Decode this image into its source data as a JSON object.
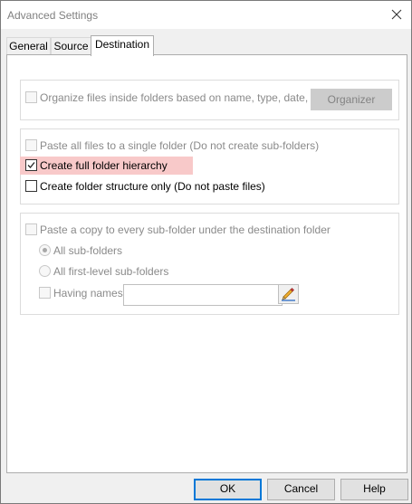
{
  "window": {
    "title": "Advanced Settings"
  },
  "tabs": [
    {
      "label": "General"
    },
    {
      "label": "Source"
    },
    {
      "label": "Destination",
      "active": true
    }
  ],
  "organize": {
    "checkbox_label": "Organize files inside folders based on name, type, date, etc",
    "checked": false,
    "enabled": false,
    "organizer_button": "Organizer"
  },
  "structure": {
    "paste_single_label": "Paste all files to a single folder (Do not create sub-folders)",
    "paste_single_checked": false,
    "full_hierarchy_label": "Create full folder hierarchy",
    "full_hierarchy_checked": true,
    "structure_only_label": "Create folder structure only (Do not paste files)",
    "structure_only_checked": false
  },
  "subfolder": {
    "paste_copy_label": "Paste a copy to every sub-folder under the destination folder",
    "paste_copy_checked": false,
    "all_subfolders_label": "All sub-folders",
    "all_subfolders_selected": true,
    "first_level_label": "All first-level sub-folders",
    "first_level_selected": false,
    "having_names_label": "Having names:",
    "having_names_checked": false,
    "names_value": ""
  },
  "footer": {
    "ok": "OK",
    "cancel": "Cancel",
    "help": "Help"
  },
  "colors": {
    "highlight": "#f8c9c9",
    "default_button_border": "#0078d7",
    "pencil": "#e8a020"
  }
}
